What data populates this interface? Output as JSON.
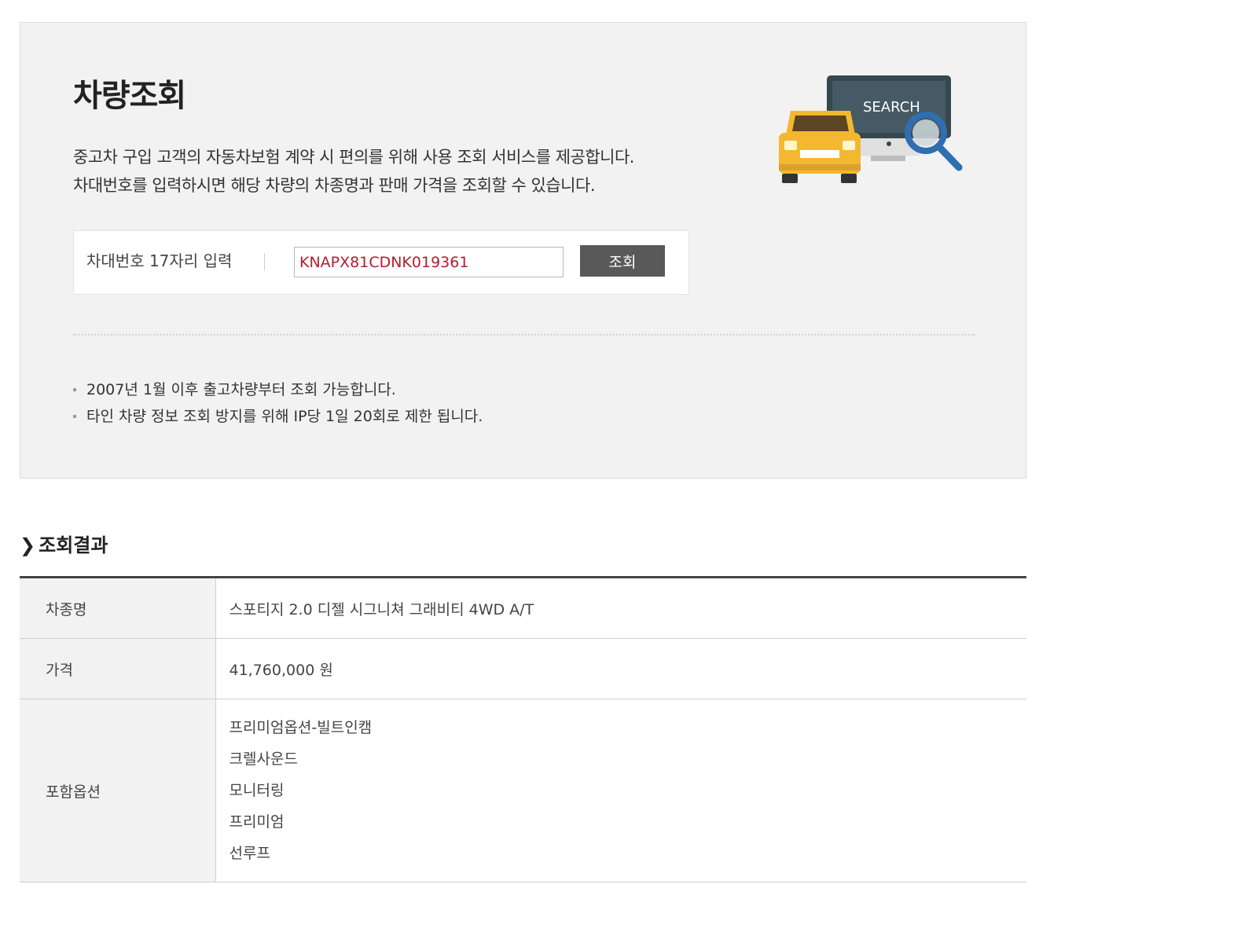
{
  "lookup": {
    "title": "차량조회",
    "description_lines": [
      "중고차 구입 고객의 자동차보험 계약 시 편의를 위해 사용 조회 서비스를 제공합니다.",
      "차대번호를 입력하시면 해당 차량의 차종명과 판매 가격을 조회할 수 있습니다."
    ],
    "search": {
      "label": "차대번호 17자리 입력",
      "input_value": "KNAPX81CDNK019361",
      "button_label": "조회"
    },
    "illustration_text": "SEARCH",
    "notices": [
      "2007년 1월 이후 출고차량부터 조회 가능합니다.",
      "타인 차량 정보 조회 방지를 위해 IP당 1일 20회로 제한 됩니다."
    ]
  },
  "result": {
    "heading": "조회결과",
    "model_label": "차종명",
    "model_value": "스포티지 2.0 디젤 시그니쳐 그래비티 4WD A/T",
    "price_label": "가격",
    "price_value": "41,760,000 원",
    "options_label": "포함옵션",
    "options": [
      "프리미엄옵션-빌트인캠",
      "크렐사운드",
      "모니터링",
      "프리미엄",
      "선루프"
    ]
  },
  "colors": {
    "panel_bg": "#f2f2f2",
    "button_bg": "#595959",
    "input_text": "#b01e2f",
    "car_yellow": "#f3b830",
    "monitor": "#37474f",
    "magnifier": "#2f6fb0"
  }
}
